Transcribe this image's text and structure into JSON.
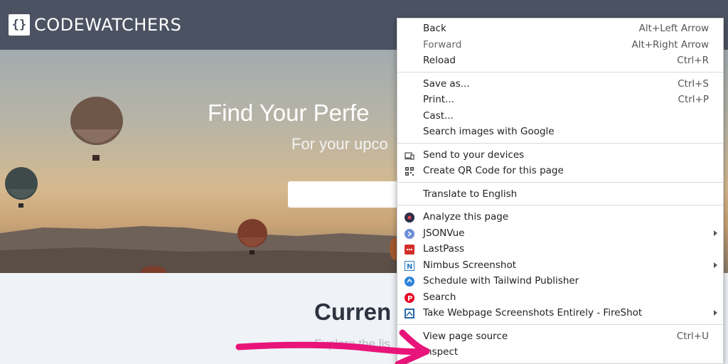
{
  "site": {
    "logo_mark": "{}",
    "logo_text": "CODEWATCHERS",
    "hero_title": "Find Your Perfe",
    "hero_subtitle": "For your upco",
    "section_title": "Curren",
    "section_subtitle": "Explore the lis"
  },
  "colors": {
    "header_bg": "#4b5262",
    "annotation_arrow": "#e8147a",
    "menu_bg": "#ffffff"
  },
  "context_menu": {
    "groups": [
      {
        "items": [
          {
            "label": "Back",
            "shortcut": "Alt+Left Arrow"
          },
          {
            "label": "Forward",
            "shortcut": "Alt+Right Arrow",
            "disabled": true
          },
          {
            "label": "Reload",
            "shortcut": "Ctrl+R"
          }
        ]
      },
      {
        "items": [
          {
            "label": "Save as...",
            "shortcut": "Ctrl+S"
          },
          {
            "label": "Print...",
            "shortcut": "Ctrl+P"
          },
          {
            "label": "Cast..."
          },
          {
            "label": "Search images with Google"
          }
        ]
      },
      {
        "items": [
          {
            "label": "Send to your devices",
            "icon": "devices-icon"
          },
          {
            "label": "Create QR Code for this page",
            "icon": "qr-code-icon"
          }
        ]
      },
      {
        "items": [
          {
            "label": "Translate to English"
          }
        ]
      },
      {
        "items": [
          {
            "label": "Analyze this page",
            "icon": "analyze-extension-icon"
          },
          {
            "label": "JSONVue",
            "icon": "jsonvue-icon",
            "submenu": true
          },
          {
            "label": "LastPass",
            "icon": "lastpass-icon"
          },
          {
            "label": "Nimbus Screenshot",
            "icon": "nimbus-icon",
            "submenu": true
          },
          {
            "label": "Schedule with Tailwind Publisher",
            "icon": "tailwind-icon"
          },
          {
            "label": "Search",
            "icon": "pinterest-icon"
          },
          {
            "label": "Take Webpage Screenshots Entirely - FireShot",
            "icon": "fireshot-icon",
            "submenu": true
          }
        ]
      },
      {
        "items": [
          {
            "label": "View page source",
            "shortcut": "Ctrl+U"
          },
          {
            "label": "Inspect"
          }
        ]
      }
    ]
  }
}
